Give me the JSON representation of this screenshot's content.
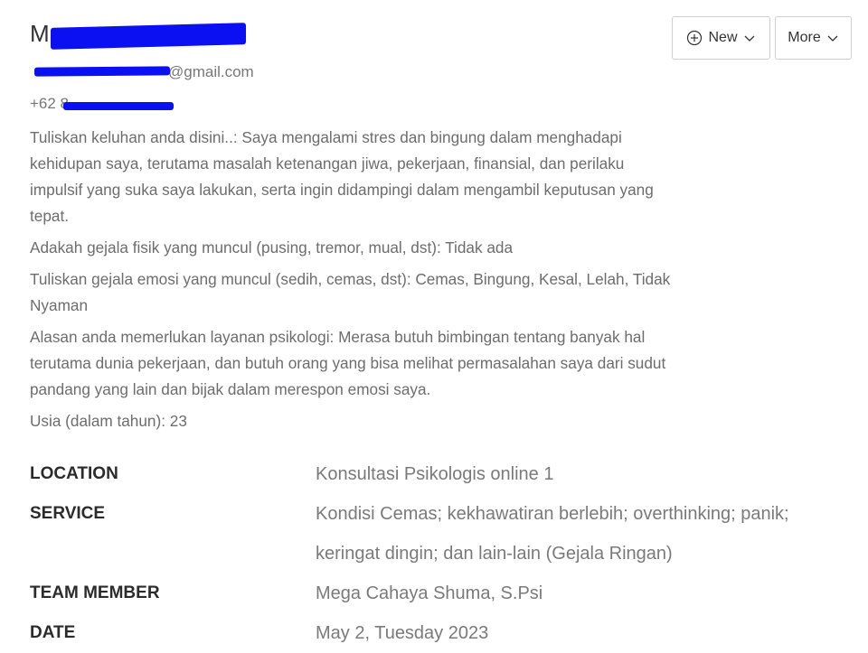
{
  "contact": {
    "name_visible": "M",
    "email_visible": "@gmail.com",
    "phone_visible": "+62 8"
  },
  "toolbar": {
    "new_label": "New",
    "more_label": "More"
  },
  "details": [
    "Tuliskan keluhan anda disini..: Saya mengalami stres dan bingung dalam menghadapi kehidupan saya, terutama masalah ketenangan jiwa, pekerjaan, finansial, dan perilaku impulsif yang suka saya lakukan, serta ingin didampingi dalam mengambil keputusan yang tepat.",
    "Adakah gejala fisik yang muncul (pusing, tremor, mual, dst): Tidak ada",
    "Tuliskan gejala emosi yang muncul (sedih, cemas, dst): Cemas, Bingung, Kesal, Lelah, Tidak Nyaman",
    "Alasan anda memerlukan layanan psikologi: Merasa butuh bimbingan tentang banyak hal terutama dunia pekerjaan, dan butuh orang yang bisa melihat permasalahan saya dari sudut pandang yang lain dan bijak dalam merespon emosi saya.",
    "Usia (dalam tahun): 23"
  ],
  "meta": {
    "location_label": "LOCATION",
    "location_value": "Konsultasi Psikologis online 1",
    "service_label": "SERVICE",
    "service_value": "Kondisi Cemas; kekhawatiran berlebih; overthinking; panik; keringat dingin; dan lain-lain (Gejala Ringan)",
    "team_label": "TEAM MEMBER",
    "team_value": "Mega Cahaya Shuma, S.Psi",
    "date_label": "DATE",
    "date_value": "May 2, Tuesday 2023"
  },
  "colors": {
    "redaction": "#0a10f2",
    "label": "#2b2b2b",
    "value": "#7a7a7a"
  }
}
